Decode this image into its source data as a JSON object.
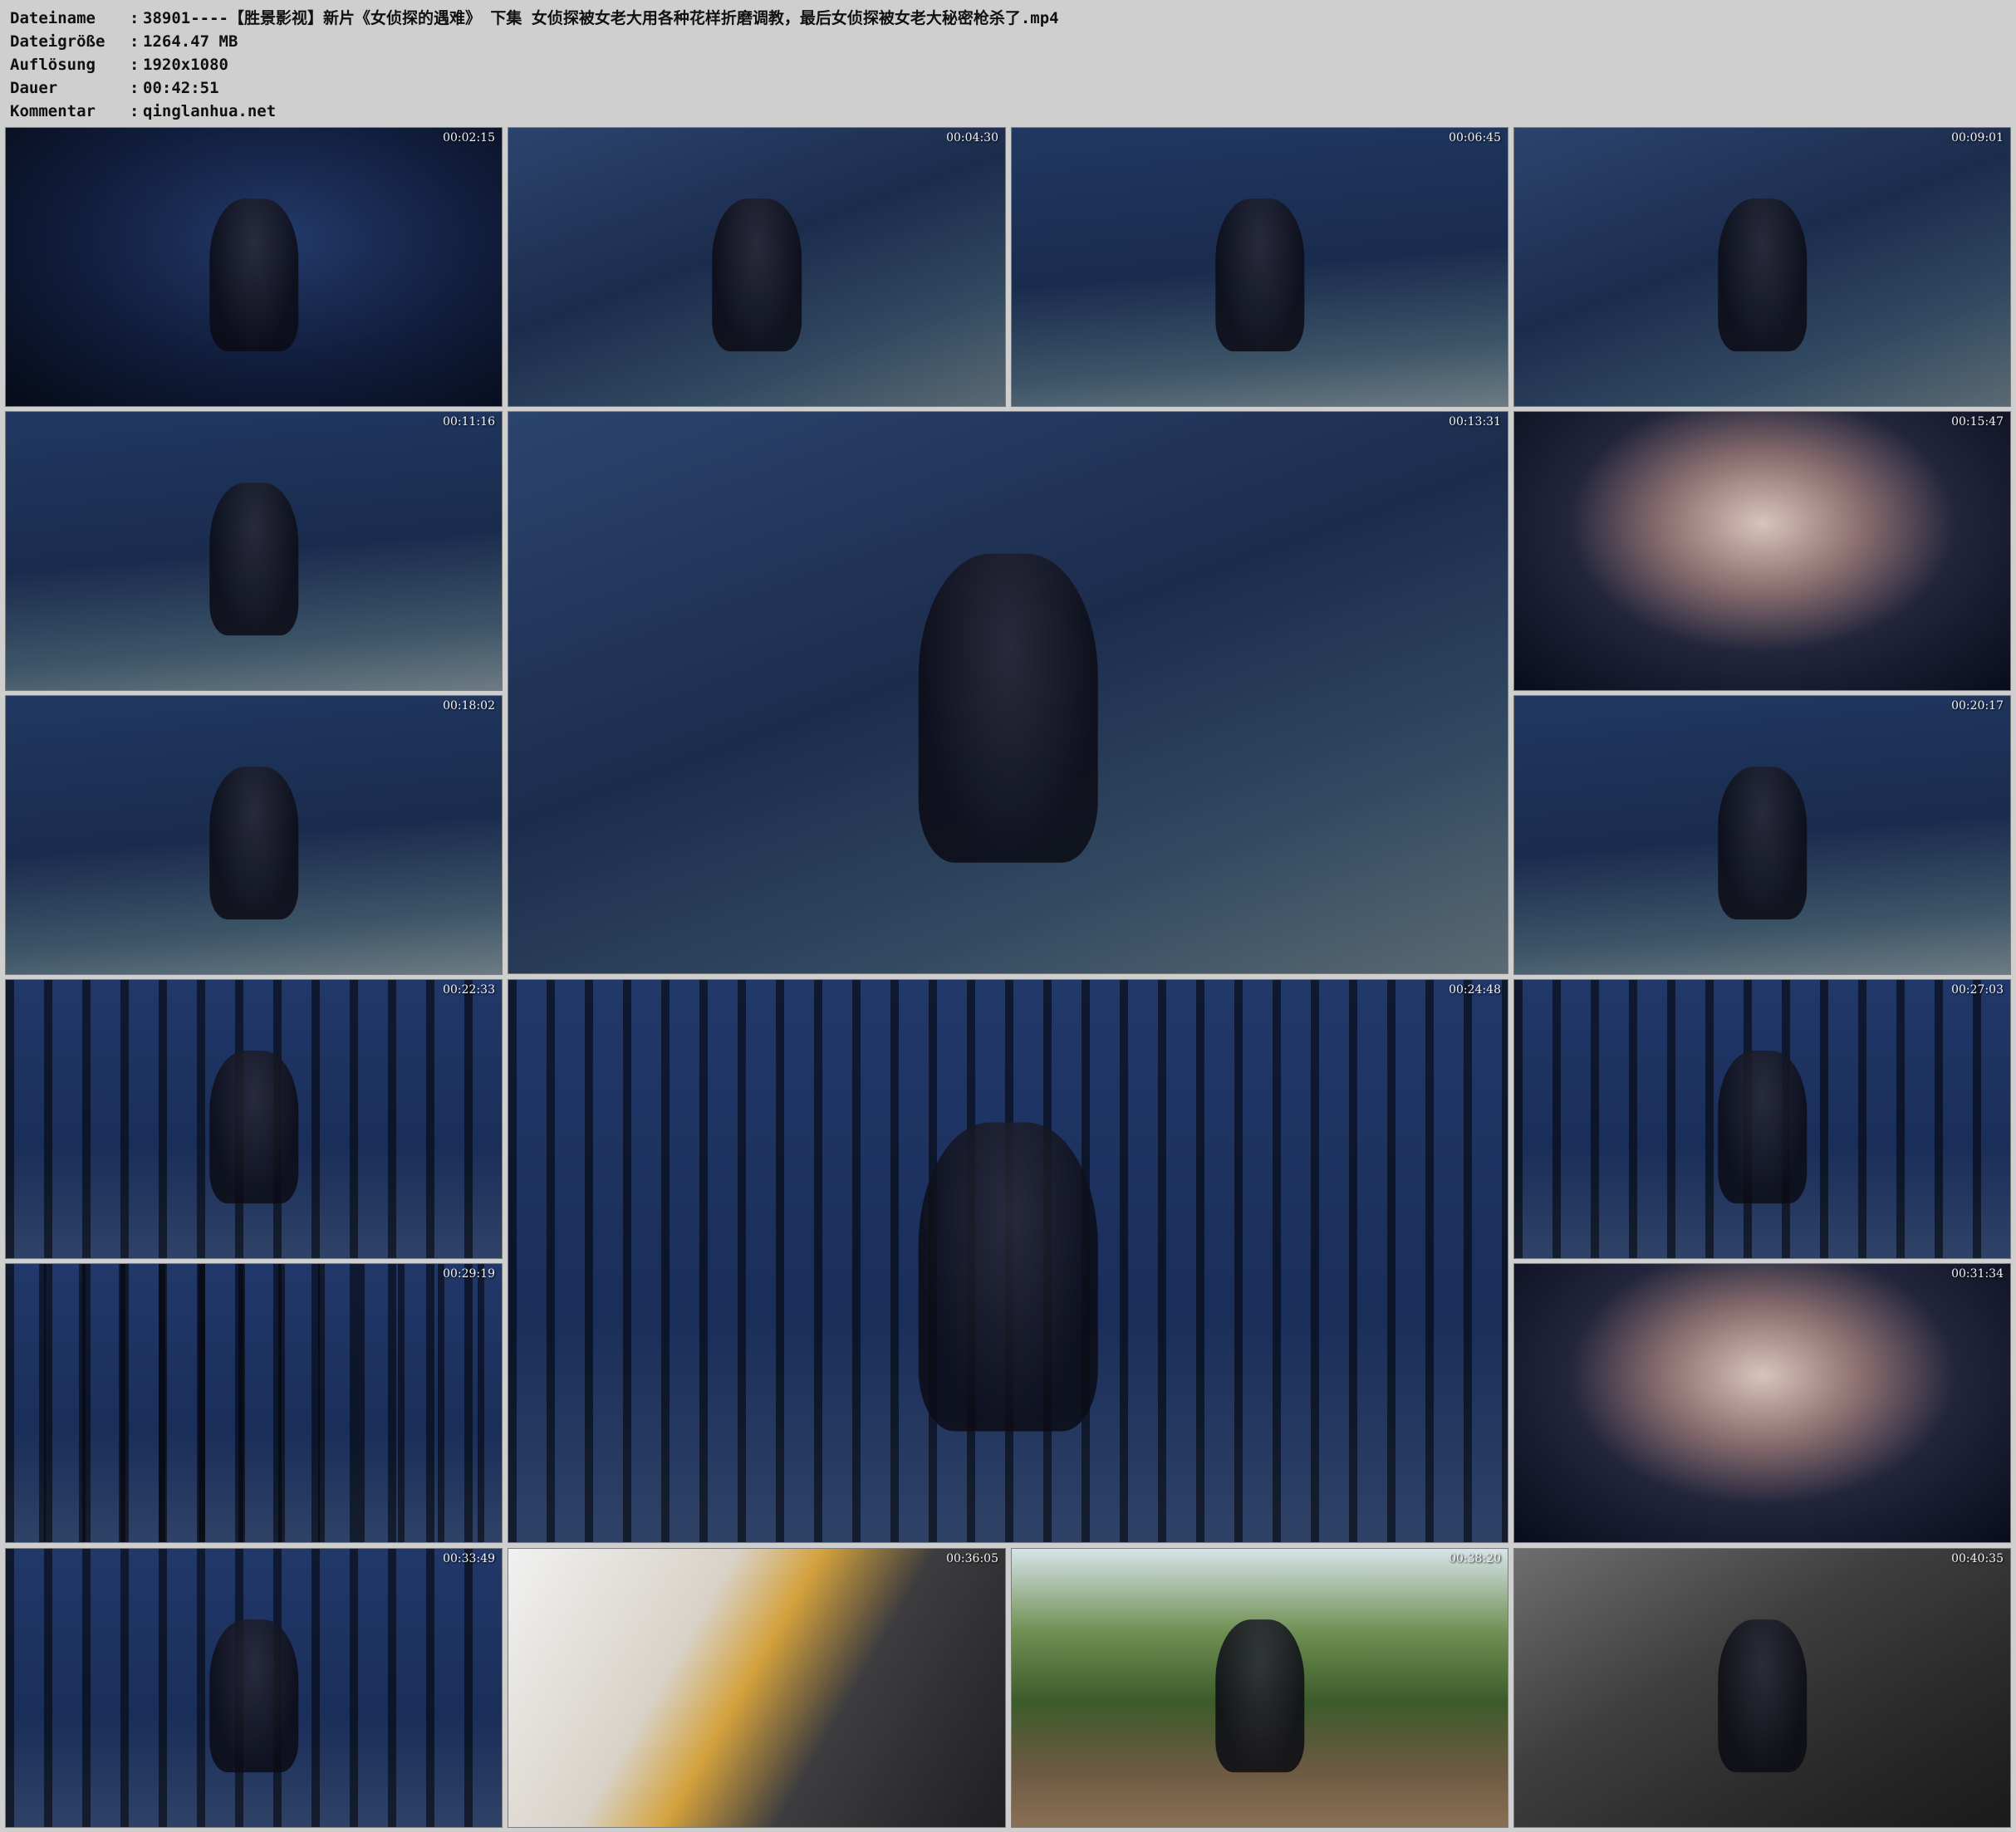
{
  "info": {
    "rows": [
      {
        "key": "Dateiname",
        "value": "38901----【胜景影视】新片《女侦探的遇难》 下集 女侦探被女老大用各种花样折磨调教，最后女侦探被女老大秘密枪杀了.mp4"
      },
      {
        "key": "Dateigröße",
        "value": "1264.47 MB"
      },
      {
        "key": "Auflösung",
        "value": "1920x1080"
      },
      {
        "key": "Dauer",
        "value": "00:42:51"
      },
      {
        "key": "Kommentar",
        "value": "qinglanhua.net"
      }
    ],
    "separator": ":"
  },
  "thumbnails": [
    {
      "time": "00:02:15"
    },
    {
      "time": "00:04:30"
    },
    {
      "time": "00:06:45"
    },
    {
      "time": "00:09:01"
    },
    {
      "time": "00:11:16"
    },
    {
      "time": "00:13:31"
    },
    {
      "time": "00:15:47"
    },
    {
      "time": "00:18:02"
    },
    {
      "time": "00:20:17"
    },
    {
      "time": "00:22:33"
    },
    {
      "time": "00:24:48"
    },
    {
      "time": "00:27:03"
    },
    {
      "time": "00:29:19"
    },
    {
      "time": "00:31:34"
    },
    {
      "time": "00:33:49"
    },
    {
      "time": "00:36:05"
    },
    {
      "time": "00:38:20"
    },
    {
      "time": "00:40:35"
    }
  ]
}
